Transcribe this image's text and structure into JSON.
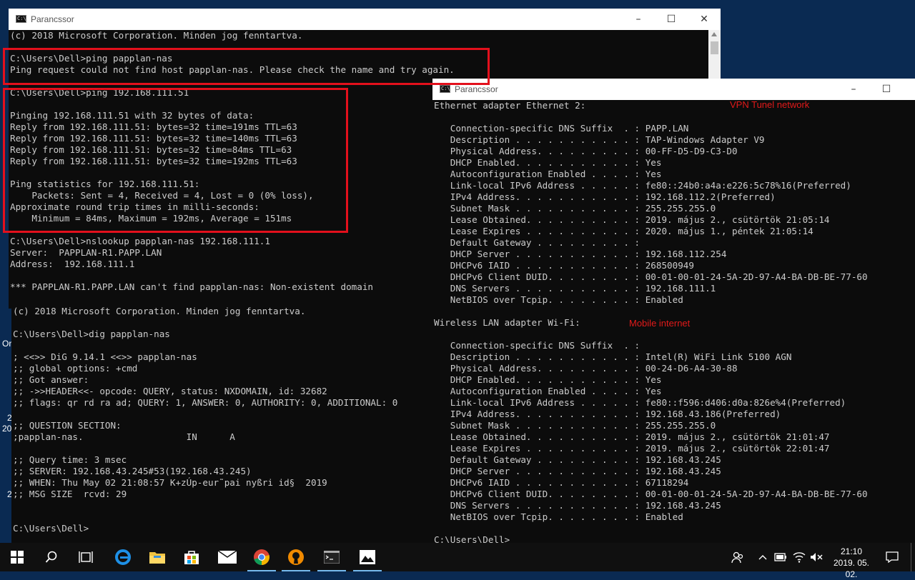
{
  "desktop": {
    "fragments": [
      "Or",
      "2",
      "20",
      "2"
    ]
  },
  "win1": {
    "title": "Parancssor",
    "lines": [
      "(c) 2018 Microsoft Corporation. Minden jog fenntartva.",
      "",
      "C:\\Users\\Dell>ping papplan-nas",
      "Ping request could not find host papplan-nas. Please check the name and try again.",
      "",
      "C:\\Users\\Dell>ping 192.168.111.51",
      "",
      "Pinging 192.168.111.51 with 32 bytes of data:",
      "Reply from 192.168.111.51: bytes=32 time=191ms TTL=63",
      "Reply from 192.168.111.51: bytes=32 time=140ms TTL=63",
      "Reply from 192.168.111.51: bytes=32 time=84ms TTL=63",
      "Reply from 192.168.111.51: bytes=32 time=192ms TTL=63",
      "",
      "Ping statistics for 192.168.111.51:",
      "    Packets: Sent = 4, Received = 4, Lost = 0 (0% loss),",
      "Approximate round trip times in milli-seconds:",
      "    Minimum = 84ms, Maximum = 192ms, Average = 151ms",
      "",
      "C:\\Users\\Dell>nslookup papplan-nas 192.168.111.1",
      "Server:  PAPPLAN-R1.PAPP.LAN",
      "Address:  192.168.111.1",
      "",
      "*** PAPPLAN-R1.PAPP.LAN can't find papplan-nas: Non-existent domain"
    ]
  },
  "win2": {
    "lines": [
      "(c) 2018 Microsoft Corporation. Minden jog fenntartva.",
      "",
      "C:\\Users\\Dell>dig papplan-nas",
      "",
      "; <<>> DiG 9.14.1 <<>> papplan-nas",
      ";; global options: +cmd",
      ";; Got answer:",
      ";; ->>HEADER<<- opcode: QUERY, status: NXDOMAIN, id: 32682",
      ";; flags: qr rd ra ad; QUERY: 1, ANSWER: 0, AUTHORITY: 0, ADDITIONAL: 0",
      "",
      ";; QUESTION SECTION:",
      ";papplan-nas.                   IN      A",
      "",
      ";; Query time: 3 msec",
      ";; SERVER: 192.168.43.245#53(192.168.43.245)",
      ";; WHEN: Thu May 02 21:08:57 K+zÚp-eur˜pai nyßri id§  2019",
      ";; MSG SIZE  rcvd: 29",
      "",
      "",
      "C:\\Users\\Dell>"
    ]
  },
  "win3": {
    "title": "Parancssor",
    "lines": [
      "Ethernet adapter Ethernet 2:",
      "",
      "   Connection-specific DNS Suffix  . : PAPP.LAN",
      "   Description . . . . . . . . . . . : TAP-Windows Adapter V9",
      "   Physical Address. . . . . . . . . : 00-FF-D5-D9-C3-D0",
      "   DHCP Enabled. . . . . . . . . . . : Yes",
      "   Autoconfiguration Enabled . . . . : Yes",
      "   Link-local IPv6 Address . . . . . : fe80::24b0:a4a:e226:5c78%16(Preferred)",
      "   IPv4 Address. . . . . . . . . . . : 192.168.112.2(Preferred)",
      "   Subnet Mask . . . . . . . . . . . : 255.255.255.0",
      "   Lease Obtained. . . . . . . . . . : 2019. május 2., csütörtök 21:05:14",
      "   Lease Expires . . . . . . . . . . : 2020. május 1., péntek 21:05:14",
      "   Default Gateway . . . . . . . . . :",
      "   DHCP Server . . . . . . . . . . . : 192.168.112.254",
      "   DHCPv6 IAID . . . . . . . . . . . : 268500949",
      "   DHCPv6 Client DUID. . . . . . . . : 00-01-00-01-24-5A-2D-97-A4-BA-DB-BE-77-60",
      "   DNS Servers . . . . . . . . . . . : 192.168.111.1",
      "   NetBIOS over Tcpip. . . . . . . . : Enabled",
      "",
      "Wireless LAN adapter Wi-Fi:",
      "",
      "   Connection-specific DNS Suffix  . :",
      "   Description . . . . . . . . . . . : Intel(R) WiFi Link 5100 AGN",
      "   Physical Address. . . . . . . . . : 00-24-D6-A4-30-88",
      "   DHCP Enabled. . . . . . . . . . . : Yes",
      "   Autoconfiguration Enabled . . . . : Yes",
      "   Link-local IPv6 Address . . . . . : fe80::f596:d406:d0a:826e%4(Preferred)",
      "   IPv4 Address. . . . . . . . . . . : 192.168.43.186(Preferred)",
      "   Subnet Mask . . . . . . . . . . . : 255.255.255.0",
      "   Lease Obtained. . . . . . . . . . : 2019. május 2., csütörtök 21:01:47",
      "   Lease Expires . . . . . . . . . . : 2019. május 2., csütörtök 22:01:47",
      "   Default Gateway . . . . . . . . . : 192.168.43.245",
      "   DHCP Server . . . . . . . . . . . : 192.168.43.245",
      "   DHCPv6 IAID . . . . . . . . . . . : 67118294",
      "   DHCPv6 Client DUID. . . . . . . . : 00-01-00-01-24-5A-2D-97-A4-BA-DB-BE-77-60",
      "   DNS Servers . . . . . . . . . . . : 192.168.43.245",
      "   NetBIOS over Tcpip. . . . . . . . : Enabled",
      "",
      "C:\\Users\\Dell>"
    ]
  },
  "annotations": {
    "vpn": "VPN Tunel network",
    "mobile": "Mobile internet",
    "color": "#e21a1a"
  },
  "taskbar": {
    "icons": [
      "windows-start",
      "search",
      "task-view",
      "edge",
      "file-explorer",
      "store",
      "mail",
      "chrome",
      "openvpn",
      "command-prompt",
      "photos"
    ],
    "clock_time": "21:10",
    "clock_date": "2019. 05. 02.",
    "accent": "#76b9ed"
  }
}
